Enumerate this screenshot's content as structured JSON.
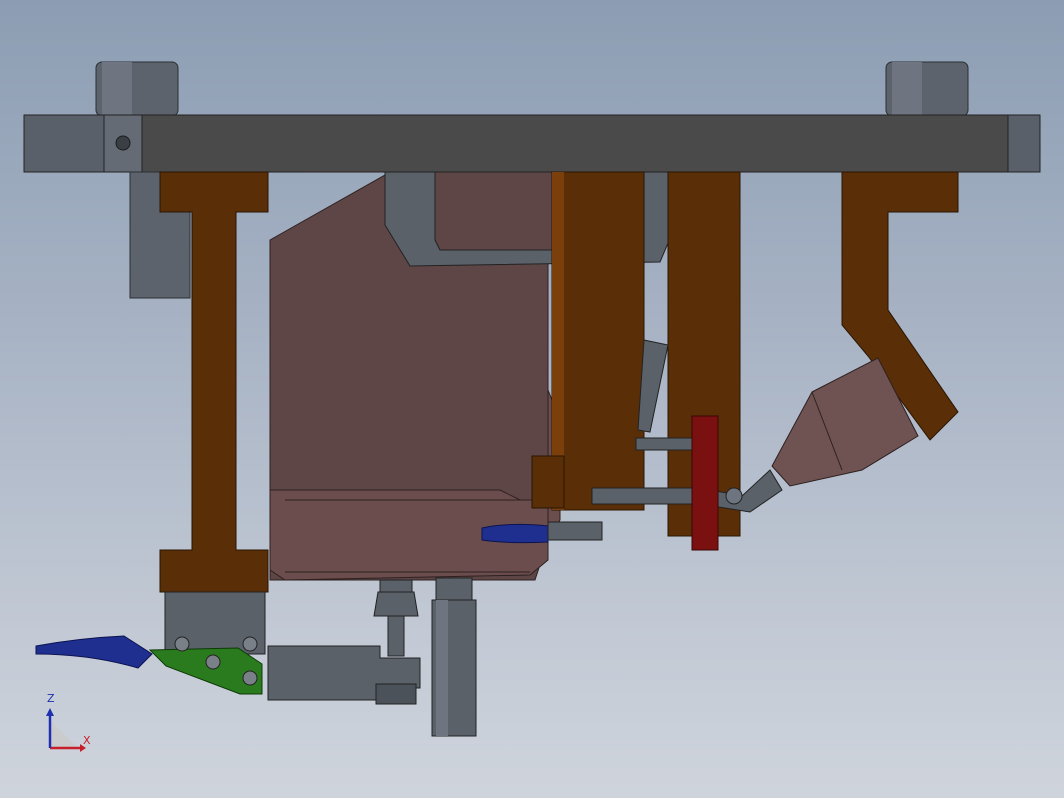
{
  "colors": {
    "background_top": "#8c9db3",
    "background_bottom": "#cfd4dc",
    "plate_dark": "#4a4a4a",
    "steel_grey": "#5f6670",
    "bracket_brown": "#5a2e07",
    "housing_mauve": "#5e4646",
    "clamp_green": "#2a7a1e",
    "handle_blue": "#1e2f8f",
    "stop_red": "#7a1010",
    "axis_x": "#c8202a",
    "axis_z": "#1e2fb0"
  },
  "triad": {
    "z_label": "Z",
    "x_label": "X",
    "icon": "coordinate-triad-icon"
  }
}
